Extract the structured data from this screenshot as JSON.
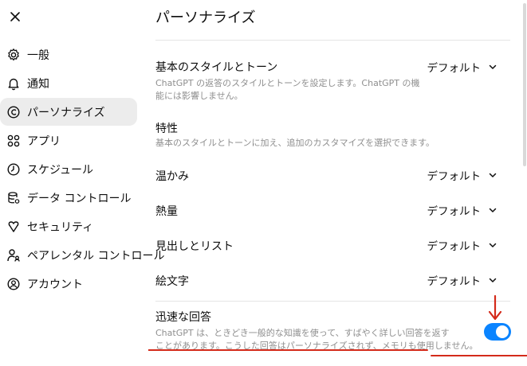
{
  "sidebar": {
    "items": [
      {
        "label": "一般",
        "icon": "gear-icon"
      },
      {
        "label": "通知",
        "icon": "bell-icon"
      },
      {
        "label": "パーソナライズ",
        "icon": "personalize-icon",
        "active": true
      },
      {
        "label": "アプリ",
        "icon": "apps-grid-icon"
      },
      {
        "label": "スケジュール",
        "icon": "clock-icon"
      },
      {
        "label": "データ コントロール",
        "icon": "database-icon"
      },
      {
        "label": "セキュリティ",
        "icon": "shield-icon"
      },
      {
        "label": "ペアレンタル コントロール",
        "icon": "parent-icon"
      },
      {
        "label": "アカウント",
        "icon": "account-icon"
      }
    ]
  },
  "main": {
    "title": "パーソナライズ",
    "base_style": {
      "label": "基本のスタイルとトーン",
      "value": "デフォルト",
      "desc_line1": "ChatGPT の返答のスタイルとトーンを設定します。ChatGPT の機",
      "desc_line2": "能には影響しません。"
    },
    "traits": {
      "label": "特性",
      "desc": "基本のスタイルとトーンに加え、追加のカスタマイズを選択できます。"
    },
    "warmth": {
      "label": "温かみ",
      "value": "デフォルト"
    },
    "enthusiasm": {
      "label": "熱量",
      "value": "デフォルト"
    },
    "headers_lists": {
      "label": "見出しとリスト",
      "value": "デフォルト"
    },
    "emoji": {
      "label": "絵文字",
      "value": "デフォルト"
    },
    "quick_answers": {
      "label": "迅速な回答",
      "desc_line1": "ChatGPT は、ときどき一般的な知識を使って、すばやく詳しい回答を返す",
      "desc_line2": "ことがあります。こうした回答はパーソナライズされず、メモリも使用しません。",
      "enabled": true
    }
  },
  "colors": {
    "toggle_on": "#0a84ff",
    "annotation": "#d42a1a",
    "active_nav_bg": "#ececec"
  }
}
